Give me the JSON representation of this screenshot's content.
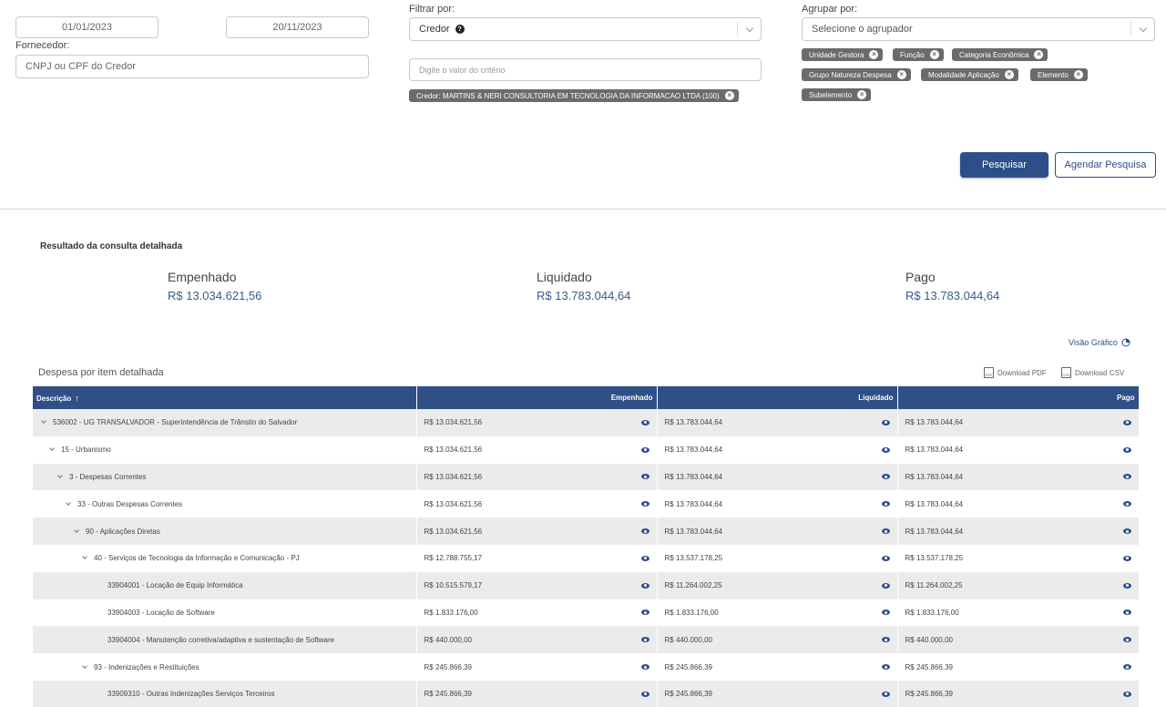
{
  "filters": {
    "date_start": "01/01/2023",
    "date_end": "20/11/2023",
    "fornecedor_label": "Fornecedor:",
    "fornecedor_placeholder": "CNPJ ou CPF do Credor",
    "filtrar_label": "Filtrar por:",
    "filtrar_value": "Credor",
    "criterio_placeholder": "Digite o valor do critério",
    "filter_chip": "Credor: MARTINS & NERI CONSULTORIA EM TECNOLOGIA DA INFORMACAO LTDA (100)",
    "agrupar_label": "Agrupar por:",
    "agrupar_placeholder": "Selecione o agrupador",
    "group_chips": [
      "Unidade Gestora",
      "Função",
      "Categoria Econômica",
      "Grupo Natureza Despesa",
      "Modalidade Aplicação",
      "Elemento",
      "Subelemento"
    ]
  },
  "buttons": {
    "pesquisar": "Pesquisar",
    "agendar": "Agendar Pesquisa"
  },
  "result": {
    "title": "Resultado da consulta detalhada",
    "empenhado_label": "Empenhado",
    "empenhado_value": "R$ 13.034.621,56",
    "liquidado_label": "Liquidado",
    "liquidado_value": "R$ 13.783.044,64",
    "pago_label": "Pago",
    "pago_value": "R$ 13.783.044,64"
  },
  "table_section": {
    "visao_grafico": "Visão Gráfico",
    "title": "Despesa por item detalhada",
    "download_pdf": "Download PDF",
    "download_csv": "Download CSV",
    "headers": {
      "descricao": "Descrição",
      "empenhado": "Empenhado",
      "liquidado": "Liquidado",
      "pago": "Pago"
    },
    "rows": [
      {
        "level": 0,
        "expandable": true,
        "desc": "536002 - UG TRANSALVADOR - Superintendência de Trânsito do Salvador",
        "emp": "R$ 13.034.621,56",
        "liq": "R$ 13.783.044,64",
        "pago": "R$ 13.783.044,64"
      },
      {
        "level": 1,
        "expandable": true,
        "desc": "15 - Urbanismo",
        "emp": "R$ 13.034.621,56",
        "liq": "R$ 13.783.044,64",
        "pago": "R$ 13.783.044,64"
      },
      {
        "level": 2,
        "expandable": true,
        "desc": "3 - Despesas Correntes",
        "emp": "R$ 13.034.621,56",
        "liq": "R$ 13.783.044,64",
        "pago": "R$ 13.783.044,64"
      },
      {
        "level": 3,
        "expandable": true,
        "desc": "33 - Outras Despesas Correntes",
        "emp": "R$ 13.034.621,56",
        "liq": "R$ 13.783.044,64",
        "pago": "R$ 13.783.044,64"
      },
      {
        "level": 4,
        "expandable": true,
        "desc": "90 - Aplicações Diretas",
        "emp": "R$ 13.034.621,56",
        "liq": "R$ 13.783.044,64",
        "pago": "R$ 13.783.044,64"
      },
      {
        "level": 5,
        "expandable": true,
        "desc": "40 - Serviços de Tecnologia da Informação e Comunicação - PJ",
        "emp": "R$ 12.788.755,17",
        "liq": "R$ 13.537.178,25",
        "pago": "R$ 13.537.178,25"
      },
      {
        "level": 6,
        "expandable": false,
        "desc": "33904001 - Locação de Equip Informática",
        "emp": "R$ 10.515.579,17",
        "liq": "R$ 11.264.002,25",
        "pago": "R$ 11.264.002,25"
      },
      {
        "level": 6,
        "expandable": false,
        "desc": "33904003 - Locação de Software",
        "emp": "R$ 1.833.176,00",
        "liq": "R$ 1.833.176,00",
        "pago": "R$ 1.833.176,00"
      },
      {
        "level": 6,
        "expandable": false,
        "desc": "33904004 - Manutenção corretiva/adaptiva e sustentação de Software",
        "emp": "R$ 440.000,00",
        "liq": "R$ 440.000,00",
        "pago": "R$ 440.000,00"
      },
      {
        "level": 5,
        "expandable": true,
        "desc": "93 - Indenizações e Restituições",
        "emp": "R$ 245.866,39",
        "liq": "R$ 245.866,39",
        "pago": "R$ 245.866,39"
      },
      {
        "level": 6,
        "expandable": false,
        "desc": "33909310 - Outras Indenizações Serviços Terceiros",
        "emp": "R$ 245.866,39",
        "liq": "R$ 245.866,39",
        "pago": "R$ 245.866,39"
      }
    ]
  },
  "icons": {
    "help": "question-circle-icon",
    "chip_remove": "close-circle-icon",
    "view": "eye-icon",
    "chart": "chart-icon",
    "sort": "arrow-up-icon",
    "tree_toggle": "chevron-down-icon"
  },
  "colors": {
    "primary": "#2c4f8a",
    "header_bg": "#2f4f86",
    "chip_bg": "#6b6b6b",
    "row_alt": "#ebebeb"
  }
}
